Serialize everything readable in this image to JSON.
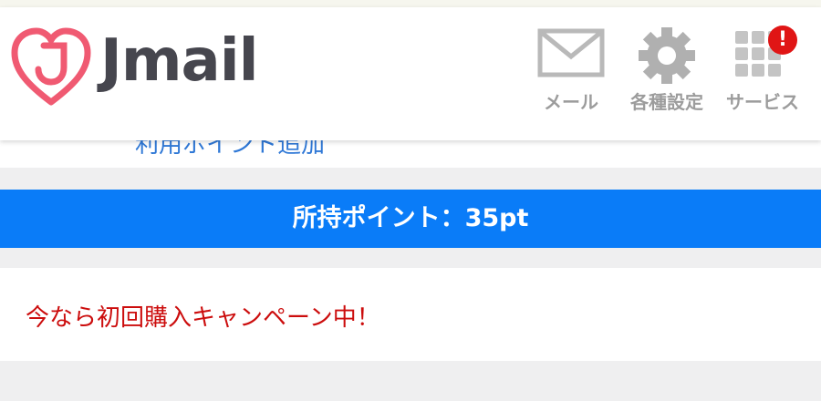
{
  "app": {
    "logo_text": "Jmail"
  },
  "header": {
    "nav": [
      {
        "label": "メール",
        "icon": "mail-icon"
      },
      {
        "label": "各種設定",
        "icon": "gear-icon"
      },
      {
        "label": "サービス",
        "icon": "grid-icon",
        "badge": "!"
      }
    ]
  },
  "behind": {
    "partial_text": "利用ポイント追加"
  },
  "points": {
    "label": "所持ポイント：35pt"
  },
  "campaign": {
    "text": "今なら初回購入キャンペーン中！"
  },
  "colors": {
    "brand": "#f05a72",
    "points_bar": "#0a7cf8",
    "campaign_text": "#cc0d0d",
    "badge": "#e01515"
  }
}
